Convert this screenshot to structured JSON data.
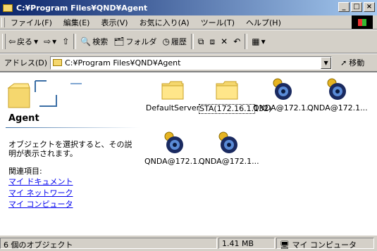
{
  "window": {
    "title": "C:¥Program Files¥QND¥Agent"
  },
  "menu": {
    "items": [
      "ファイル(F)",
      "編集(E)",
      "表示(V)",
      "お気に入り(A)",
      "ツール(T)",
      "ヘルプ(H)"
    ]
  },
  "toolbar": {
    "back_label": "戻る",
    "search_label": "検索",
    "folders_label": "フォルダ",
    "history_label": "履歴"
  },
  "address": {
    "label": "アドレス(D)",
    "value": "C:¥Program Files¥QND¥Agent",
    "go_label": "移動"
  },
  "panel": {
    "title": "Agent",
    "description": "オブジェクトを選択すると、その説明が表示されます。",
    "related_label": "関連項目:",
    "links": [
      "マイ ドキュメント",
      "マイ ネットワーク",
      "マイ コンピュータ"
    ]
  },
  "files": [
    {
      "name": "DefaultServer",
      "icon": "folder-icon"
    },
    {
      "name": "STA(172.16.1.132)",
      "icon": "folder-icon",
      "selected": true
    },
    {
      "name": "QNDA@172.1...",
      "icon": "agent-gear-icon"
    },
    {
      "name": "QNDA@172.1...",
      "icon": "agent-gear-icon"
    },
    {
      "name": "QNDA@172.1...",
      "icon": "agent-gear-icon"
    },
    {
      "name": "QNDA@172.1...",
      "icon": "agent-gear-icon"
    }
  ],
  "status": {
    "count": "6 個のオブジェクト",
    "size": "1.41 MB",
    "location": "マイ コンピュータ"
  },
  "colors": {
    "titlebar_start": "#0a246a",
    "titlebar_end": "#a6caf0",
    "chrome": "#d4d0c8",
    "link": "#0000ee",
    "folder": "#f5d76e"
  }
}
